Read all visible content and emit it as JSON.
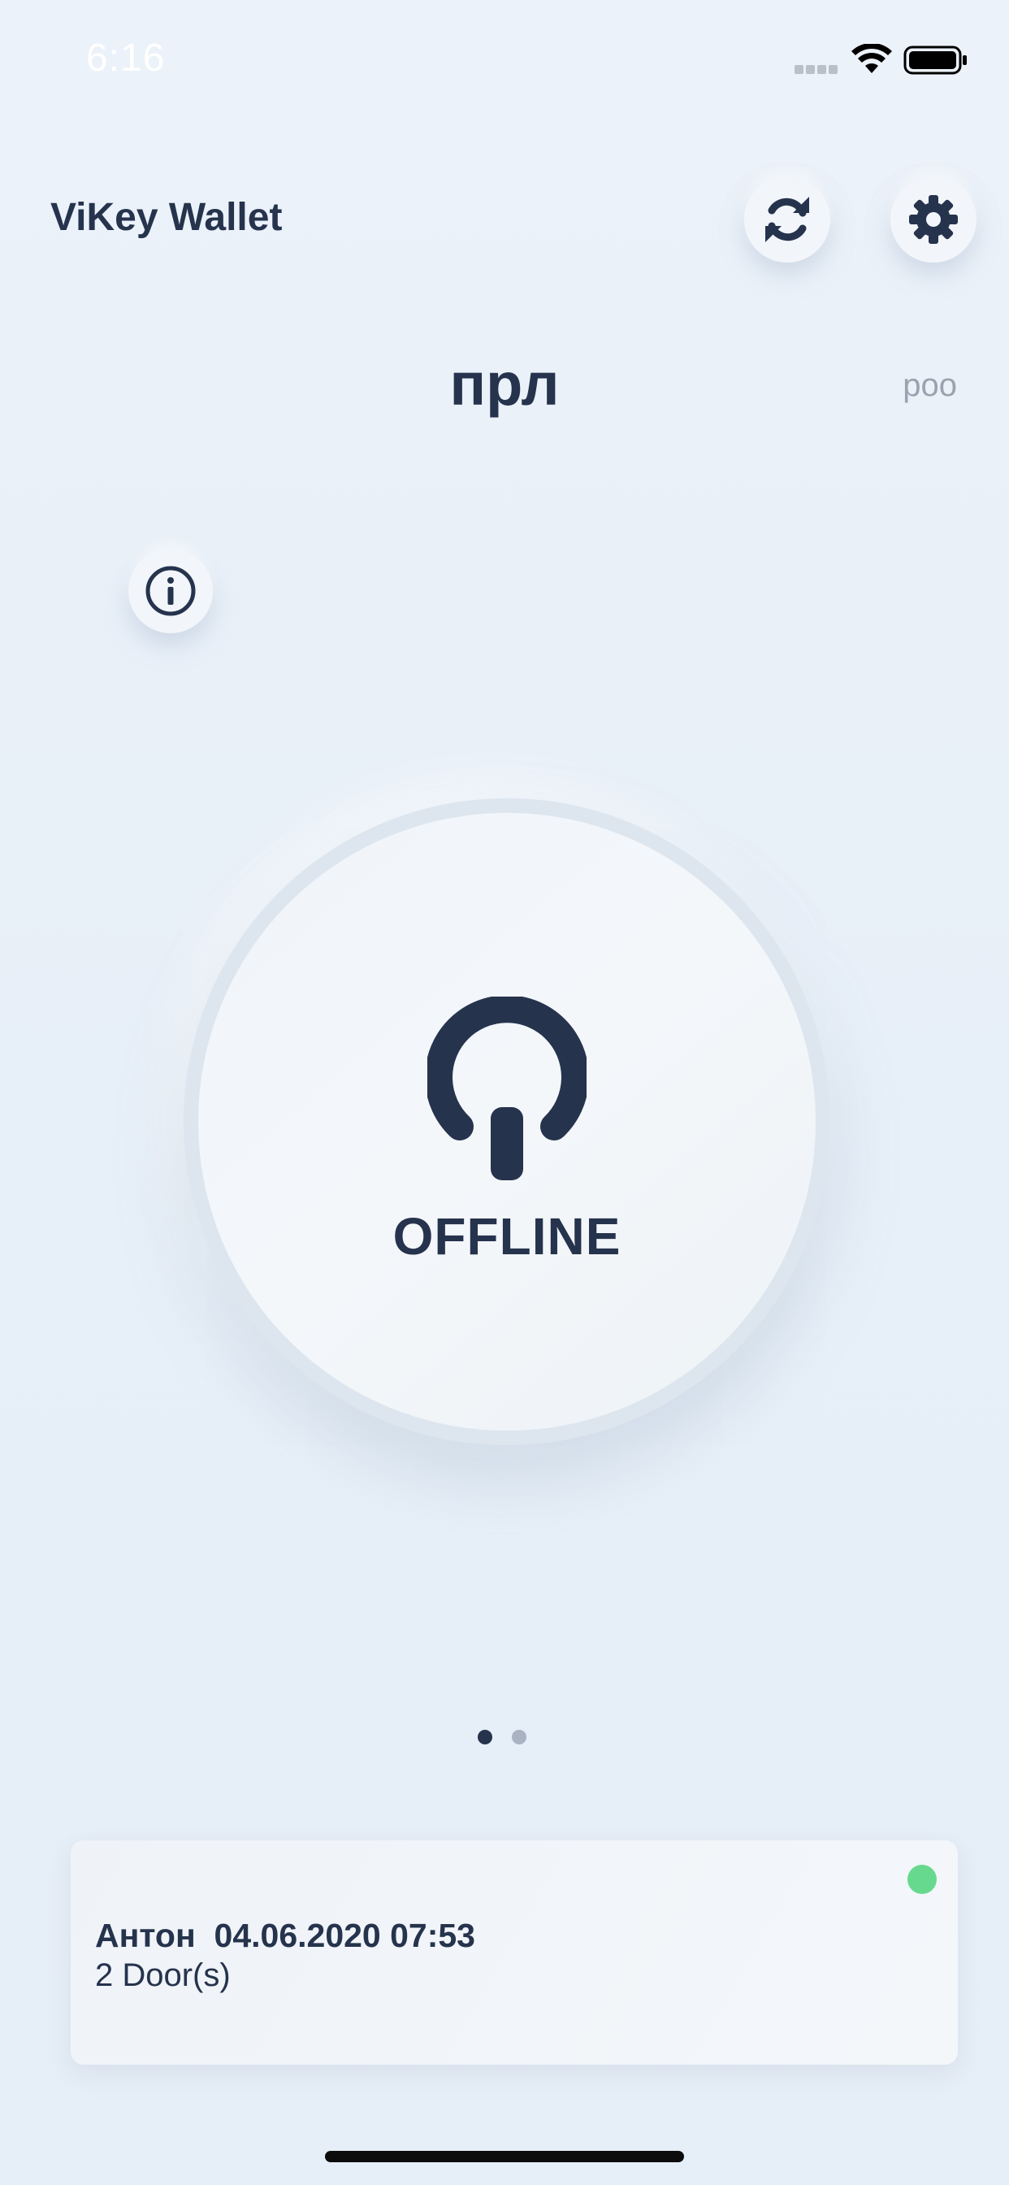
{
  "status_bar": {
    "time": "6:16",
    "icons": [
      "signal-icon",
      "wifi-icon",
      "battery-icon"
    ]
  },
  "header": {
    "title": "ViKey Wallet",
    "refresh_icon": "refresh-icon",
    "settings_icon": "gear-icon"
  },
  "card": {
    "title": "прл",
    "subtitle": "роо",
    "info_icon": "info-icon"
  },
  "power_button": {
    "icon": "power-icon",
    "label": "OFFLINE"
  },
  "pager": {
    "count": 2,
    "active_index": 0
  },
  "log": {
    "name": "Антон",
    "datetime": "04.06.2020 07:53",
    "doors": "2 Door(s)",
    "status_color": "#67d98e"
  },
  "colors": {
    "primary": "#26334d",
    "background": "#e9f0f8",
    "status_online": "#67d98e"
  }
}
